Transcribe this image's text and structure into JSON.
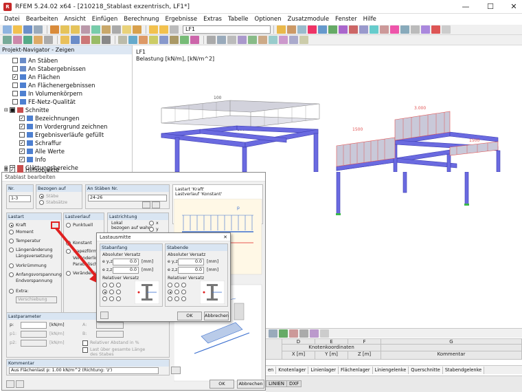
{
  "window": {
    "title": "RFEM 5.24.02 x64 - [210218_Stablast exzentrisch, LF1*]",
    "minimize": "—",
    "maximize": "☐",
    "close": "✕"
  },
  "menu": [
    "Datei",
    "Bearbeiten",
    "Ansicht",
    "Einfügen",
    "Berechnung",
    "Ergebnisse",
    "Extras",
    "Tabelle",
    "Optionen",
    "Zusatzmodule",
    "Fenster",
    "Hilfe"
  ],
  "toolbar": {
    "loadcase": "LF1"
  },
  "navigator": {
    "title": "Projekt-Navigator - Zeigen",
    "items": [
      {
        "label": "An Stäben",
        "checked": false
      },
      {
        "label": "An Stabergebnissen",
        "checked": false
      },
      {
        "label": "An Flächen",
        "checked": true
      },
      {
        "label": "An Flächenergebnissen",
        "checked": false
      },
      {
        "label": "In Volumenkörpern",
        "checked": false
      },
      {
        "label": "FE-Netz-Qualität",
        "checked": false
      },
      {
        "label": "Schnitte",
        "checked": false
      },
      {
        "label": "Bezeichnungen",
        "checked": true
      },
      {
        "label": "Im Vordergrund zeichnen",
        "checked": true
      },
      {
        "label": "Ergebnisverläufe gefüllt",
        "checked": false
      },
      {
        "label": "Schraffur",
        "checked": true
      },
      {
        "label": "Alle Werte",
        "checked": true
      },
      {
        "label": "Info",
        "checked": true
      },
      {
        "label": "Glättungsbereiche",
        "checked": true
      },
      {
        "label": "Hilfsobjekte",
        "checked": true
      }
    ]
  },
  "view": {
    "line1": "LF1",
    "line2": "Belastung [kN/m], [kN/m^2]",
    "label_100_a": "100",
    "label_100_b": "100",
    "label_1500_a": "1500",
    "label_1500_b": "1500",
    "label_3000": "3.000"
  },
  "dialog": {
    "title": "Stablast bearbeiten",
    "nr_header": "Nr.",
    "nr_value": "1-3",
    "bezogen_header": "Bezogen auf",
    "bezogen_options": [
      "Stäbe",
      "Stabsätze",
      "Stabsätze"
    ],
    "an_staben_header": "An Stäben Nr.",
    "an_staben_value": "24-26",
    "lastart_header": "Lastart",
    "lastart_options": [
      "Kraft",
      "Moment",
      "Temperatur",
      "Längenänderung",
      "Längsversetzung",
      "Vorkrümmung",
      "Anfangsvorspannung",
      "Endvorspannung",
      "Extra:"
    ],
    "extra_value": "Verschiebung",
    "lastverlauf_header": "Lastverlauf",
    "lastverlauf_options": [
      "Punktuell",
      "Konstant",
      "Trapezförmig",
      "Veränderlich",
      "Parabolisch",
      "Veränderlich..."
    ],
    "lastrichtung_header": "Lastrichtung",
    "lastrichtung_lines": [
      "Lokal",
      "bezogen auf wahre",
      "Stablänge"
    ],
    "lastrichtung_axes": [
      "x",
      "y",
      "z"
    ],
    "preview_line1": "Lastart 'Kraft'",
    "preview_line2": "Lastverlauf 'Konstant'",
    "preview_p": "p",
    "lastparameter_header": "Lastparameter",
    "param_p": "p:",
    "param_p_unit": "[kN/m]",
    "param_p1": "p1:",
    "param_p2": "p2:",
    "param_A": "A:",
    "param_B": "B:",
    "rel_abstand": "Relativer Abstand in %",
    "last_ueber": "Last über gesamte Länge",
    "des_stabes": "des Stabes",
    "kommentar_header": "Kommentar",
    "kommentar_value": "Aus Flächenlast p: 1.00 kN/m^2 (Richtung: 'z')",
    "ok": "OK",
    "abbrechen": "Abbrechen"
  },
  "dialog2": {
    "title": "Lastausmitte",
    "stabanfang": "Stabanfang",
    "stabende": "Stabende",
    "absoluter": "Absoluter Versatz",
    "ey": "e y,z:",
    "ez": "e z,z:",
    "value": "0.0",
    "unit": "[mm]",
    "relativer": "Relativer Versatz",
    "ok": "OK",
    "abbrechen": "Abbrechen"
  },
  "table": {
    "col_d": "D",
    "col_e": "E",
    "col_f": "F",
    "col_g": "G",
    "knoten": "Knotenkoordinaten",
    "xm": "X [m]",
    "ym": "Y [m]",
    "zm": "Z [m]",
    "kommentar": "Kommentar"
  },
  "tabs": [
    "en",
    "Knotenlager",
    "Linienlager",
    "Flächenlager",
    "Liniengelenke",
    "Querschnitte",
    "Stabendgelenke"
  ],
  "statusbar": {
    "linien": "LINIEN",
    "dxf": "DXF"
  },
  "colors": {
    "beam": "#5a5ad6",
    "load_red": "#e05252",
    "load_fill": "#c8c8d8",
    "header_blue": "#dde7f3"
  }
}
